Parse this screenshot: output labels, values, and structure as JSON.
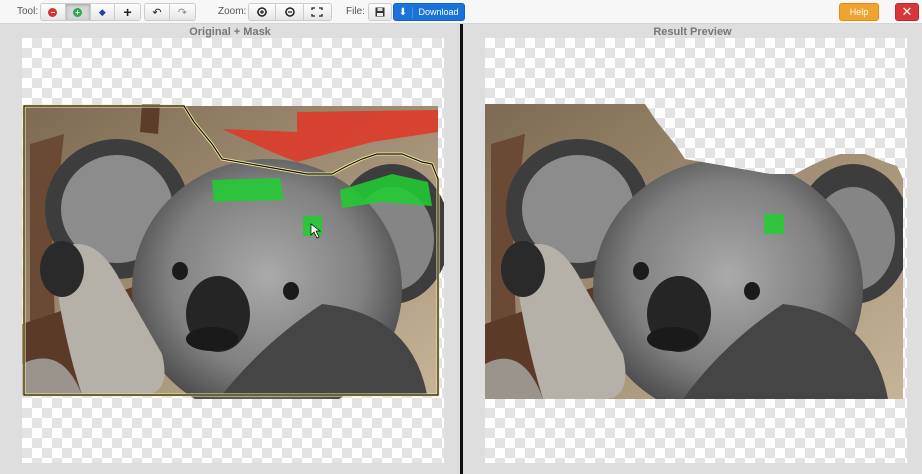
{
  "toolbar": {
    "tool_label": "Tool:",
    "zoom_label": "Zoom:",
    "file_label": "File:",
    "tools": [
      {
        "icon": "remove-circle-icon",
        "color": "#d23434"
      },
      {
        "icon": "add-circle-icon",
        "color": "#2ea84a",
        "active": true
      },
      {
        "icon": "eraser-icon",
        "color": "#1c3db8"
      },
      {
        "icon": "move-icon"
      }
    ],
    "history": [
      {
        "icon": "undo-icon"
      },
      {
        "icon": "redo-icon"
      }
    ],
    "zoom": [
      {
        "icon": "zoom-in-icon"
      },
      {
        "icon": "zoom-out-icon"
      },
      {
        "icon": "fit-screen-icon"
      }
    ],
    "save_icon": "save-icon",
    "download_label": "Download",
    "help_label": "Help",
    "close_symbol": "✕"
  },
  "panels": {
    "left_title": "Original + Mask",
    "right_title": "Result Preview"
  },
  "colors": {
    "download": "#1a73d9",
    "help": "#f0a32f",
    "close": "#d9363a",
    "keep_mask": "#22cc33",
    "remove_mask": "#dd3a2a"
  }
}
